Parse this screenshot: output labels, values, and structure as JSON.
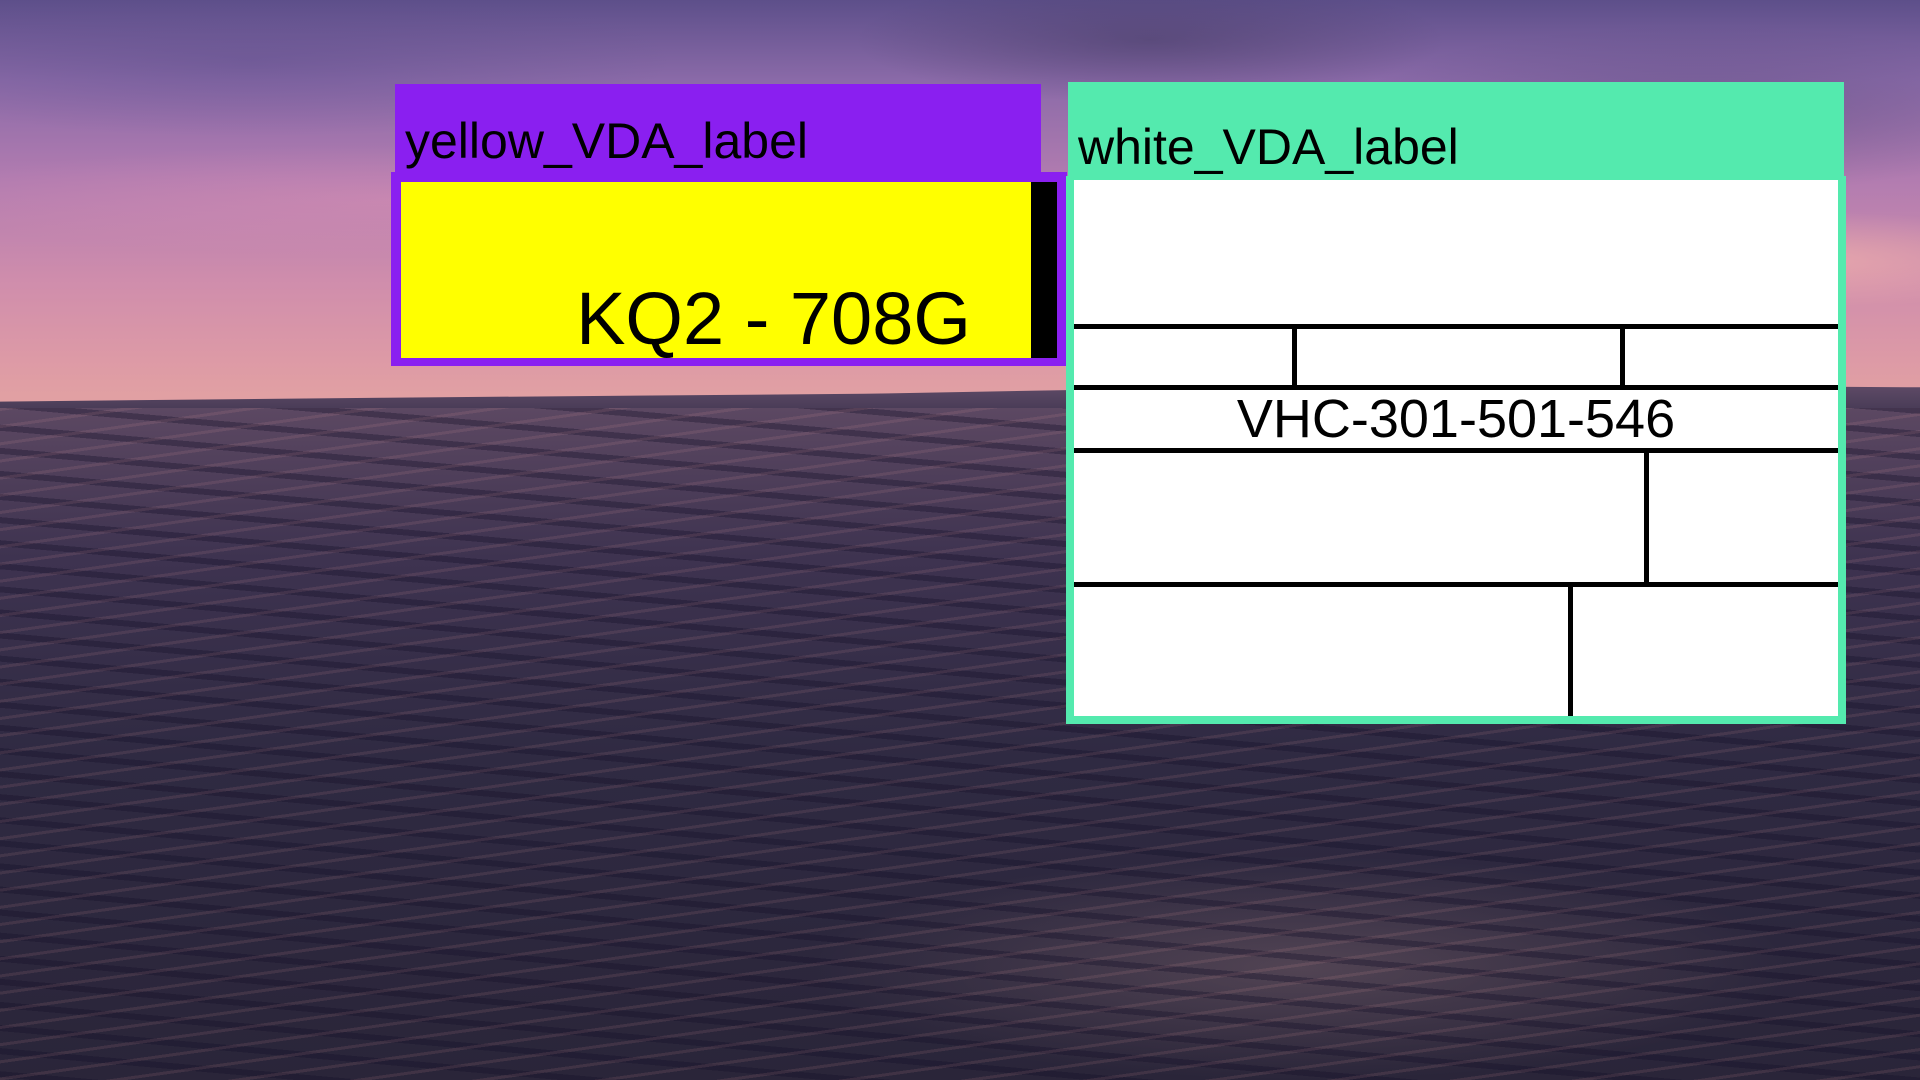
{
  "labels": {
    "yellow": {
      "tag": "yellow_VDA_label",
      "text": "KQ2 - 708G",
      "tag_color": "#8a1ff0",
      "fill_color": "#ffff00"
    },
    "white": {
      "tag": "white_VDA_label",
      "text": "VHC-301-501-546",
      "tag_color": "#54eaae",
      "fill_color": "#ffffff"
    }
  }
}
